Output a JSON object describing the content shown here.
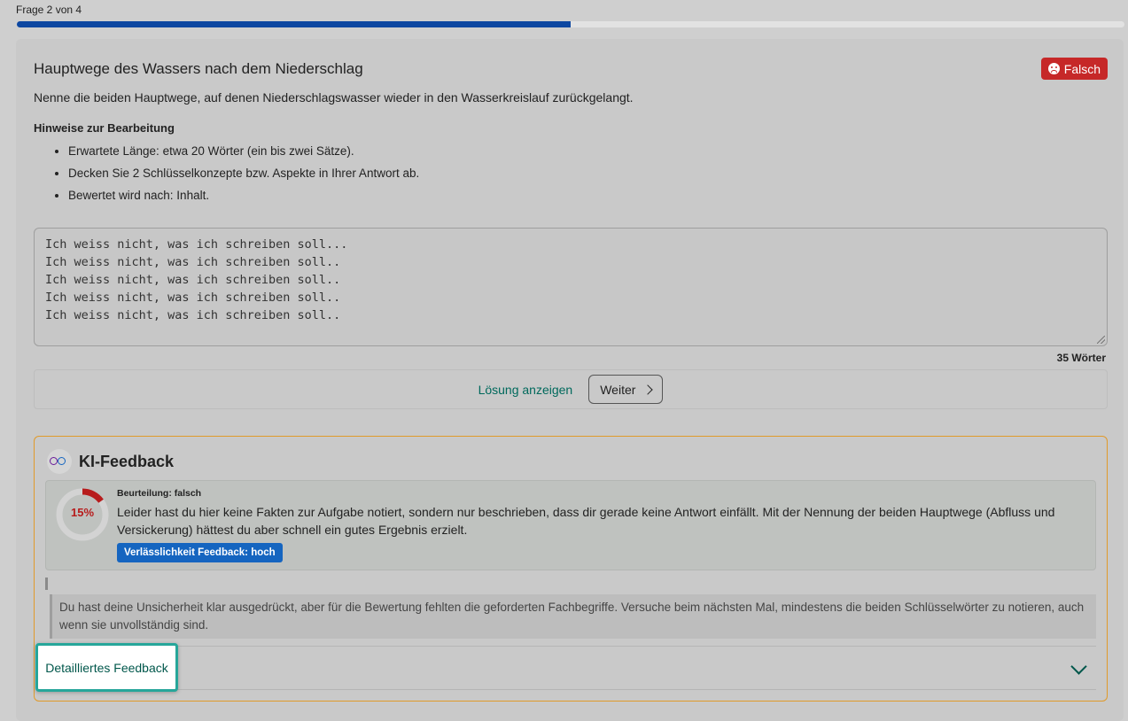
{
  "header": {
    "question_counter": "Frage 2 von 4",
    "progress": 0.5
  },
  "question": {
    "title": "Hauptwege des Wassers nach dem Niederschlag",
    "status_badge": "Falsch",
    "description": "Nenne die beiden Hauptwege, auf denen Niederschlagswasser wieder in den Wasserkreislauf zurückgelangt.",
    "hints_title": "Hinweise zur Bearbeitung",
    "hints": [
      "Erwartete Länge: etwa 20 Wörter (ein bis zwei Sätze).",
      "Decken Sie 2 Schlüsselkonzepte bzw. Aspekte in Ihrer Antwort ab.",
      "Bewertet wird nach: Inhalt."
    ]
  },
  "answer": {
    "text": "Ich weiss nicht, was ich schreiben soll...\nIch weiss nicht, was ich schreiben soll..\nIch weiss nicht, was ich schreiben soll..\nIch weiss nicht, was ich schreiben soll..\nIch weiss nicht, was ich schreiben soll..",
    "word_count": "35 Wörter"
  },
  "actions": {
    "show_solution": "Lösung anzeigen",
    "next": "Weiter"
  },
  "feedback": {
    "title": "KI-Feedback",
    "score_label": "15%",
    "score": 0.15,
    "assessment_label": "Beurteilung: falsch",
    "assessment_text": "Leider hast du hier keine Fakten zur Aufgabe notiert, sondern nur beschrieben, dass dir gerade keine Antwort einfällt. Mit der Nennung der beiden Hauptwege (Abfluss und Versickerung) hättest du aber schnell ein gutes Ergebnis erzielt.",
    "reliability_badge": "Verlässlichkeit Feedback: hoch",
    "quote": "Du hast deine Unsicherheit klar ausgedrückt, aber für die Bewertung fehlten die geforderten Fachbegriffe. Versuche beim nächsten Mal, mindestens die beiden Schlüsselwörter zu notieren, auch wenn sie unvollständig sind.",
    "detail_button": "Detailliertes Feedback"
  },
  "colors": {
    "accent": "#0d47a1",
    "error": "#c62828",
    "teal": "#26a69a",
    "orange_border": "#e09a2a"
  }
}
